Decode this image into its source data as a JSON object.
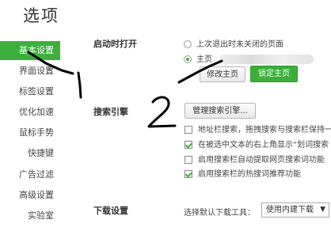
{
  "title": "选项",
  "sidebar": {
    "items": [
      {
        "label": "基本设置",
        "active": true
      },
      {
        "label": "界面设置"
      },
      {
        "label": "标签设置"
      },
      {
        "label": "优化加速"
      },
      {
        "label": "鼠标手势"
      },
      {
        "label": "快捷键"
      },
      {
        "label": "广告过滤"
      },
      {
        "label": "高级设置"
      },
      {
        "label": "实验室"
      }
    ]
  },
  "startup": {
    "label": "启动时打开",
    "option_last": "上次退出时未关闭的页面",
    "option_home": "主页",
    "selected": "主页",
    "modify_home_btn": "修改主页",
    "lock_home_btn": "锁定主页"
  },
  "search": {
    "label": "搜索引擎",
    "manage_btn": "管理搜索引擎...",
    "options": [
      {
        "label": "地址栏搜索，拖拽搜索与搜索栏保持一",
        "checked": false
      },
      {
        "label": "在被选中文本的右上角显示“划词搜索",
        "checked": true
      },
      {
        "label": "启用搜索栏自动提取网页搜索词功能",
        "checked": false
      },
      {
        "label": "启用搜索栏的热搜词推荐功能",
        "checked": true
      }
    ]
  },
  "download": {
    "label": "下载设置",
    "tool_label": "选择默认下载工具：",
    "tool_value": "使用内建下载"
  },
  "annotations": {
    "numbers": [
      "1",
      "2"
    ],
    "color": "#000000"
  },
  "colors": {
    "accent": "#3caf3c"
  }
}
